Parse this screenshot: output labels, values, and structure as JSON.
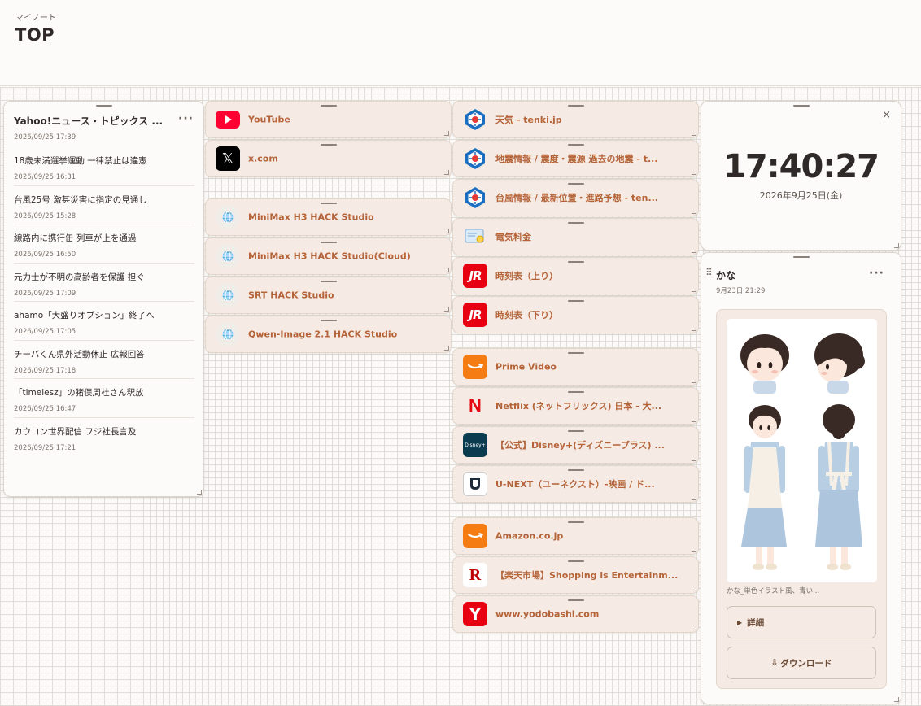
{
  "header": {
    "subtitle": "マイノート",
    "title": "TOP"
  },
  "news": {
    "title": "Yahoo!ニュース・トピックス ...",
    "time": "2026/09/25 17:39",
    "items": [
      {
        "title": "18歳未満選挙運動 一律禁止は違憲",
        "time": "2026/09/25 16:31"
      },
      {
        "title": "台風25号 激甚災害に指定の見通し",
        "time": "2026/09/25 15:28"
      },
      {
        "title": "線路内に携行缶 列車が上を通過",
        "time": "2026/09/25 16:50"
      },
      {
        "title": "元力士が不明の高齢者を保護 担ぐ",
        "time": "2026/09/25 17:09"
      },
      {
        "title": "ahamo「大盛りオプション」終了へ",
        "time": "2026/09/25 17:05"
      },
      {
        "title": "チーバくん県外活動休止 広報回答",
        "time": "2026/09/25 17:18"
      },
      {
        "title": "「timelesz」の猪俣周杜さん釈放",
        "time": "2026/09/25 16:47"
      },
      {
        "title": "カウコン世界配信 フジ社長言及",
        "time": "2026/09/25 17:21"
      }
    ]
  },
  "bookmarks": {
    "col1a": [
      {
        "label": "YouTube",
        "icon": "youtube-icon"
      },
      {
        "label": "x.com",
        "icon": "x-icon"
      }
    ],
    "col1b": [
      {
        "label": "MiniMax H3 HACK Studio",
        "icon": "globe-icon"
      },
      {
        "label": "MiniMax H3 HACK Studio(Cloud)",
        "icon": "globe-icon"
      },
      {
        "label": "SRT HACK Studio",
        "icon": "globe-icon"
      },
      {
        "label": "Qwen-Image 2.1 HACK Studio",
        "icon": "globe-icon"
      }
    ],
    "col2a": [
      {
        "label": "天気 - tenki.jp",
        "icon": "tenki-icon"
      },
      {
        "label": "地震情報 / 震度・震源 過去の地震 - t...",
        "icon": "tenki-icon"
      },
      {
        "label": "台風情報 / 最新位置・進路予想 - ten...",
        "icon": "tenki-icon"
      },
      {
        "label": "電気料金",
        "icon": "bill-icon"
      },
      {
        "label": "時刻表（上り）",
        "icon": "jr-icon"
      },
      {
        "label": "時刻表（下り）",
        "icon": "jr-icon"
      }
    ],
    "col2b": [
      {
        "label": "Prime Video",
        "icon": "amazon-icon"
      },
      {
        "label": "Netflix (ネットフリックス) 日本 - 大...",
        "icon": "netflix-icon"
      },
      {
        "label": "【公式】Disney+(ディズニープラス) ...",
        "icon": "disney-icon"
      },
      {
        "label": "U-NEXT（ユーネクスト）-映画 / ド...",
        "icon": "unext-icon"
      }
    ],
    "col2c": [
      {
        "label": "Amazon.co.jp",
        "icon": "amazon-icon"
      },
      {
        "label": "【楽天市場】Shopping is Entertainm...",
        "icon": "rakuten-icon"
      },
      {
        "label": "www.yodobashi.com",
        "icon": "yodobashi-icon"
      }
    ]
  },
  "clock": {
    "time": "17:40:27",
    "date": "2026年9月25日(金)",
    "close": "×"
  },
  "memo": {
    "title": "かな",
    "time": "9月23日 21:29",
    "caption": "かな_単色イラスト風、青い...",
    "details_label": "詳細",
    "details_icon": "▶",
    "download_label": "ダウンロード",
    "download_icon": "⇩"
  },
  "colors": {
    "accent": "#b5643a",
    "youtube": "#ff0033",
    "amazon": "#f57c12",
    "netflix": "#e50914",
    "jr": "#e60012"
  }
}
